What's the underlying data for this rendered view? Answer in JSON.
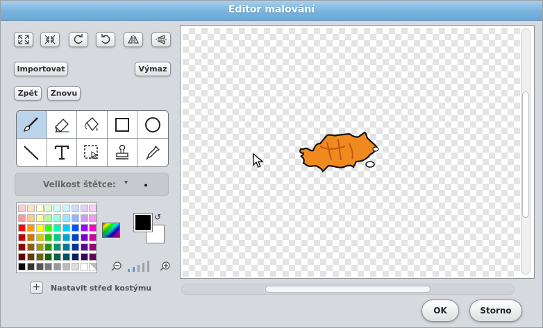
{
  "window": {
    "title": "Editor malování"
  },
  "toolbar": {
    "transform_icons": [
      "grow-icon",
      "shrink-icon",
      "rotate-left-icon",
      "rotate-right-icon",
      "flip-horizontal-icon",
      "flip-vertical-icon"
    ],
    "import_label": "Importovat",
    "clear_label": "Výmaz",
    "undo_label": "Zpět",
    "redo_label": "Znovu"
  },
  "tools": {
    "active": "paintbrush",
    "items": [
      "paintbrush-icon",
      "eraser-icon",
      "fill-bucket-icon",
      "rectangle-icon",
      "ellipse-icon",
      "line-icon",
      "text-icon",
      "select-icon",
      "stamp-icon",
      "eyedropper-icon"
    ]
  },
  "brush": {
    "label": "Velikost štětce:"
  },
  "palette": {
    "rows": [
      [
        "#ffcccc",
        "#ffe0c0",
        "#ffffc8",
        "#d6ffcc",
        "#ccffee",
        "#ccf2ff",
        "#ccd9ff",
        "#e0ccff",
        "#ffccf2"
      ],
      [
        "#ff9999",
        "#ffcc88",
        "#ffff99",
        "#aaff99",
        "#99ffdd",
        "#99e5ff",
        "#99b3ff",
        "#cc99ff",
        "#ff99e5"
      ],
      [
        "#ff0000",
        "#ff9900",
        "#ffff00",
        "#33ff00",
        "#00ffaa",
        "#00ccff",
        "#0055ff",
        "#9900ff",
        "#ff00cc"
      ],
      [
        "#cc0000",
        "#cc7a00",
        "#cccc00",
        "#29cc00",
        "#00cc88",
        "#00a3cc",
        "#0044cc",
        "#7a00cc",
        "#cc00a3"
      ],
      [
        "#990000",
        "#995c00",
        "#999900",
        "#1f9900",
        "#009966",
        "#007a99",
        "#003399",
        "#5c0099",
        "#99007a"
      ],
      [
        "#660000",
        "#663d00",
        "#666600",
        "#146600",
        "#006644",
        "#005266",
        "#002266",
        "#3d0066",
        "#660052"
      ],
      [
        "#000000",
        "#333333",
        "#555555",
        "#777777",
        "#999999",
        "#bbbbbb",
        "#dddddd",
        "#ffffff",
        "transparent"
      ]
    ],
    "foreground": "#000000",
    "background": "#ffffff"
  },
  "costume": {
    "set_center_label": "Nastavit střed kostýmu"
  },
  "footer": {
    "ok_label": "OK",
    "cancel_label": "Storno"
  }
}
